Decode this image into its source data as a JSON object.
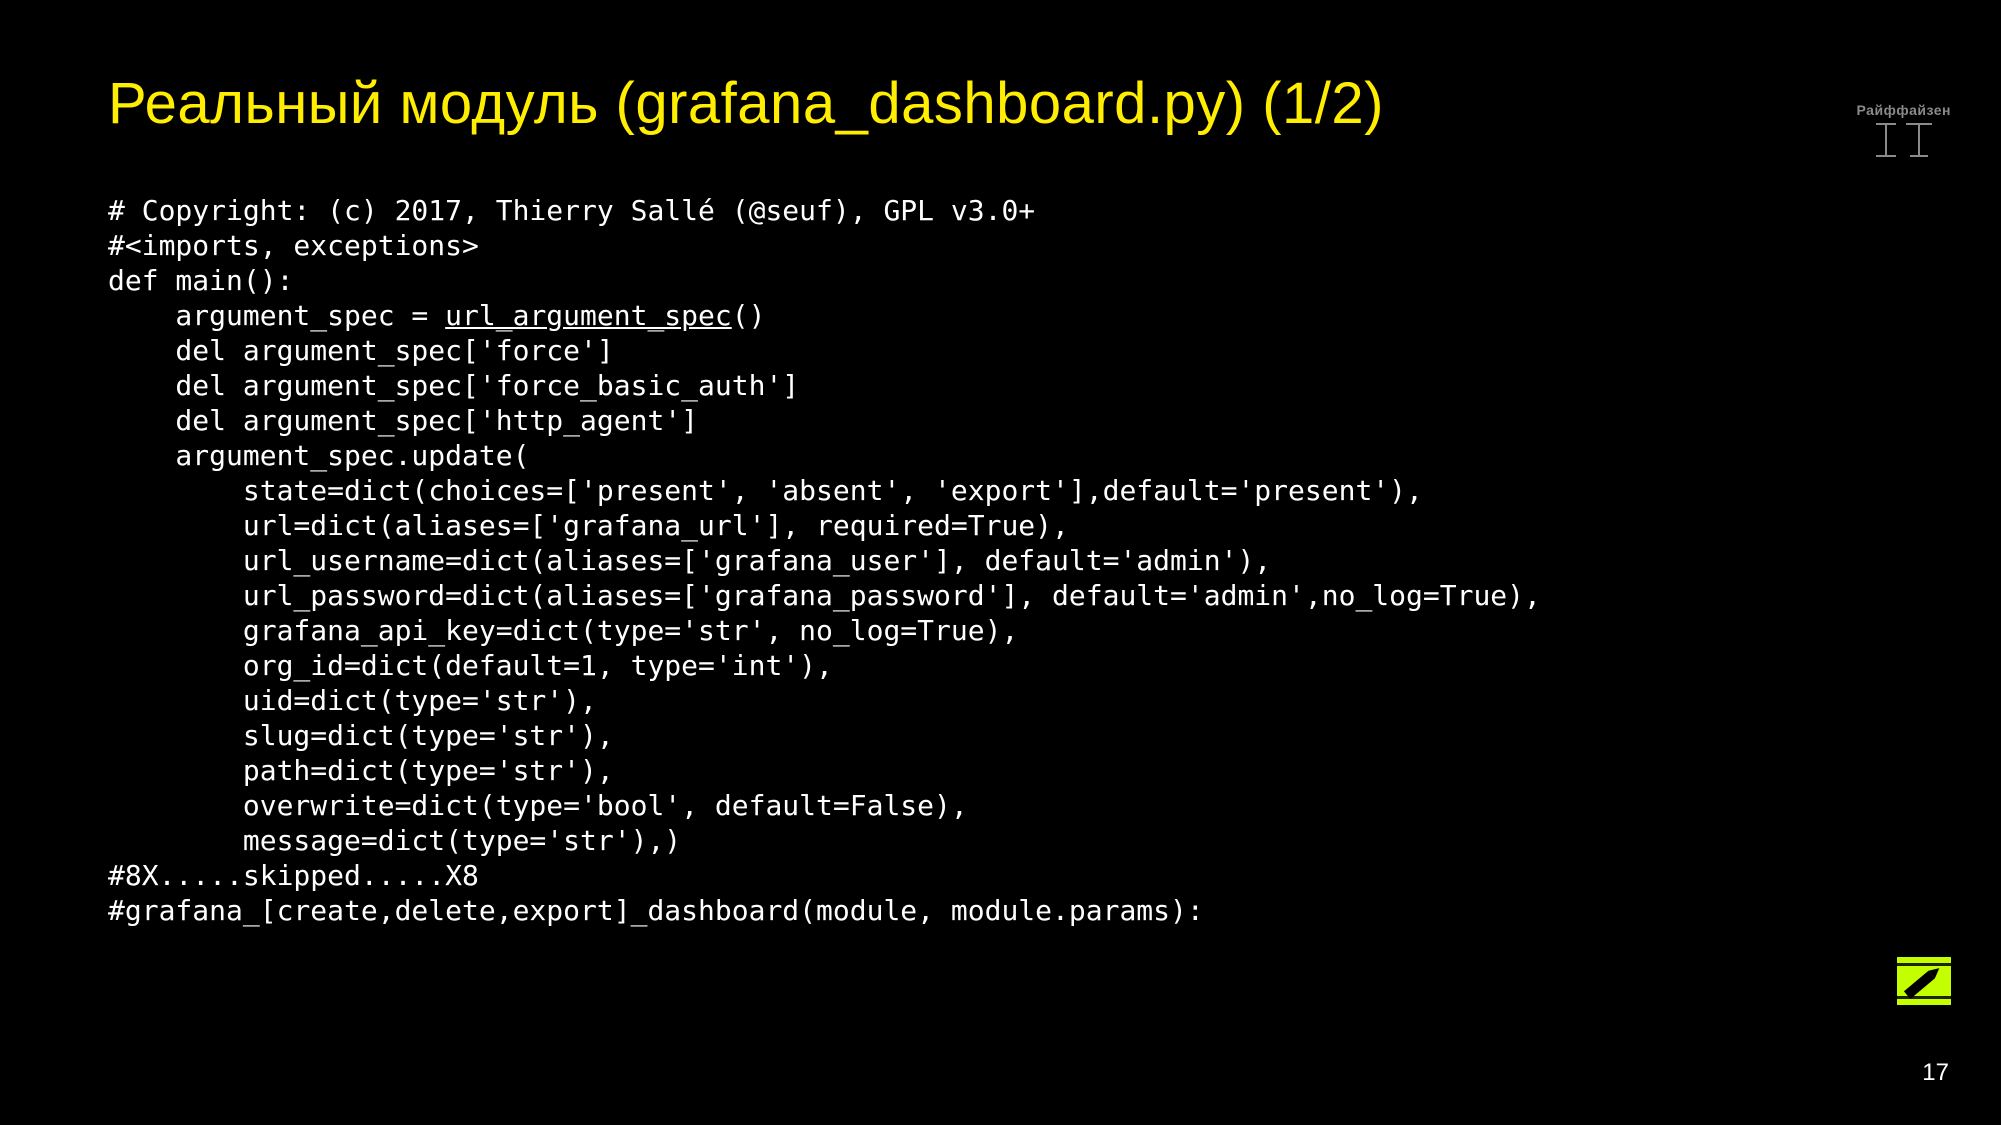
{
  "slide": {
    "title": "Реальный модуль (grafana_dashboard.py) (1/2)",
    "page_number": "17",
    "brand": "Райффайзен"
  },
  "code": {
    "l0": "# Copyright: (c) 2017, Thierry Sallé (@seuf), GPL v3.0+",
    "l1": "#<imports, exceptions>",
    "l2": "def main():",
    "l3a": "    argument_spec = ",
    "l3b": "url_argument_spec",
    "l3c": "()",
    "l4": "    del argument_spec['force']",
    "l5": "    del argument_spec['force_basic_auth']",
    "l6": "    del argument_spec['http_agent']",
    "l7": "    argument_spec.update(",
    "l8": "        state=dict(choices=['present', 'absent', 'export'],default='present'),",
    "l9": "        url=dict(aliases=['grafana_url'], required=True),",
    "l10": "        url_username=dict(aliases=['grafana_user'], default='admin'),",
    "l11": "        url_password=dict(aliases=['grafana_password'], default='admin',no_log=True),",
    "l12": "        grafana_api_key=dict(type='str', no_log=True),",
    "l13": "        org_id=dict(default=1, type='int'),",
    "l14": "        uid=dict(type='str'),",
    "l15": "        slug=dict(type='str'),",
    "l16": "        path=dict(type='str'),",
    "l17": "        overwrite=dict(type='bool', default=False),",
    "l18": "        message=dict(type='str'),)",
    "l19": "#8X.....skipped.....X8",
    "l20": "#grafana_[create,delete,export]_dashboard(module, module.params):"
  }
}
